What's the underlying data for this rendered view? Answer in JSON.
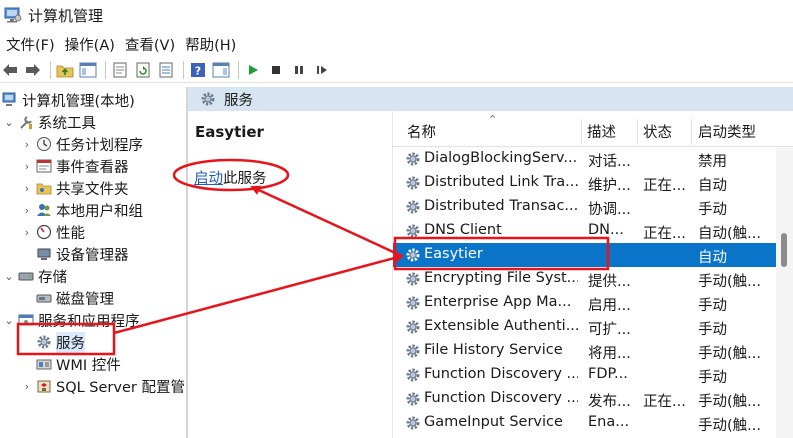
{
  "window": {
    "title": "计算机管理",
    "icon": "computer-management-icon"
  },
  "menu": [
    "文件(F)",
    "操作(A)",
    "查看(V)",
    "帮助(H)"
  ],
  "toolbar": [
    "back-arrow-icon",
    "forward-arrow-icon",
    "up-folder-icon",
    "show-tree-icon",
    "properties-icon",
    "refresh-icon",
    "export-list-icon",
    "help-icon",
    "show-action-pane-icon",
    "start-service-icon",
    "stop-service-icon",
    "pause-service-icon",
    "restart-service-icon"
  ],
  "tree": {
    "root": "计算机管理(本地)",
    "items": [
      {
        "label": "系统工具",
        "level": 1,
        "chevron": "down",
        "icon": "tools-icon"
      },
      {
        "label": "任务计划程序",
        "level": 2,
        "chevron": "right",
        "icon": "clock-icon"
      },
      {
        "label": "事件查看器",
        "level": 2,
        "chevron": "right",
        "icon": "event-viewer-icon"
      },
      {
        "label": "共享文件夹",
        "level": 2,
        "chevron": "right",
        "icon": "shared-folder-icon"
      },
      {
        "label": "本地用户和组",
        "level": 2,
        "chevron": "right",
        "icon": "users-icon"
      },
      {
        "label": "性能",
        "level": 2,
        "chevron": "right",
        "icon": "performance-icon"
      },
      {
        "label": "设备管理器",
        "level": 2,
        "chevron": "",
        "icon": "device-manager-icon"
      },
      {
        "label": "存储",
        "level": 1,
        "chevron": "down",
        "icon": "storage-icon"
      },
      {
        "label": "磁盘管理",
        "level": 2,
        "chevron": "",
        "icon": "disk-icon"
      },
      {
        "label": "服务和应用程序",
        "level": 1,
        "chevron": "down",
        "icon": "services-apps-icon"
      },
      {
        "label": "服务",
        "level": 2,
        "chevron": "",
        "icon": "gear-icon",
        "selected": true
      },
      {
        "label": "WMI 控件",
        "level": 2,
        "chevron": "",
        "icon": "wmi-icon"
      },
      {
        "label": "SQL Server 配置管",
        "level": 2,
        "chevron": "right",
        "icon": "sql-server-icon"
      }
    ]
  },
  "panel": {
    "header": "服务",
    "icon": "gear-icon"
  },
  "detail": {
    "service_name": "Easytier",
    "link_text": "启动",
    "link_suffix": "此服务"
  },
  "columns": {
    "name": "名称",
    "description": "描述",
    "status": "状态",
    "startup": "启动类型"
  },
  "services": [
    {
      "name": "DialogBlockingServ...",
      "description": "对话...",
      "status": "",
      "startup": "禁用"
    },
    {
      "name": "Distributed Link Tra...",
      "description": "维护...",
      "status": "正在...",
      "startup": "自动"
    },
    {
      "name": "Distributed Transac...",
      "description": "协调...",
      "status": "",
      "startup": "手动"
    },
    {
      "name": "DNS Client",
      "description": "DN...",
      "status": "正在...",
      "startup": "自动(触..."
    },
    {
      "name": "Easytier",
      "description": "",
      "status": "",
      "startup": "自动",
      "selected": true
    },
    {
      "name": "Encrypting File Syst...",
      "description": "提供...",
      "status": "",
      "startup": "手动(触..."
    },
    {
      "name": "Enterprise App Ma...",
      "description": "启用...",
      "status": "",
      "startup": "手动"
    },
    {
      "name": "Extensible Authenti...",
      "description": "可扩...",
      "status": "",
      "startup": "手动"
    },
    {
      "name": "File History Service",
      "description": "将用...",
      "status": "",
      "startup": "手动(触..."
    },
    {
      "name": "Function Discovery ...",
      "description": "FDP...",
      "status": "",
      "startup": "手动"
    },
    {
      "name": "Function Discovery ...",
      "description": "发布...",
      "status": "正在...",
      "startup": "手动(触..."
    },
    {
      "name": "GameInput Service",
      "description": "Ena...",
      "status": "",
      "startup": "手动(触..."
    }
  ],
  "colors": {
    "selection": "#0a74c9",
    "panel_header": "#d7e4f2",
    "annotation": "#e8141b",
    "link": "#1a5fb4"
  }
}
